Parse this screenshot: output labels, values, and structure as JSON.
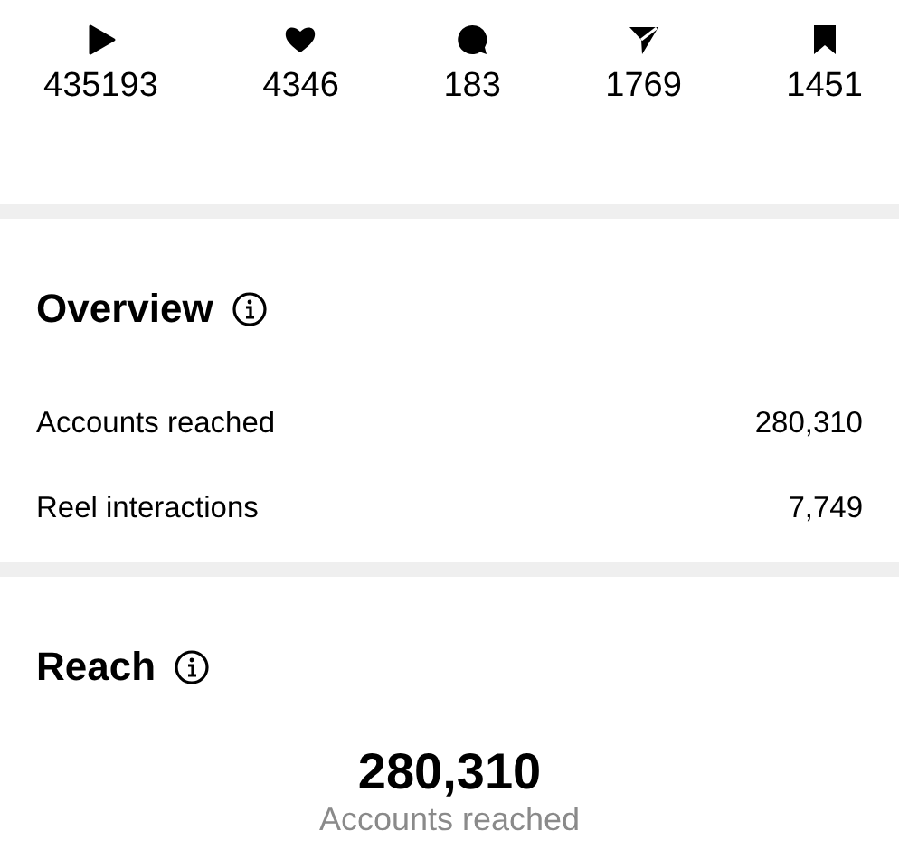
{
  "stats": [
    {
      "kind": "plays",
      "value": "435193"
    },
    {
      "kind": "likes",
      "value": "4346"
    },
    {
      "kind": "comments",
      "value": "183"
    },
    {
      "kind": "shares",
      "value": "1769"
    },
    {
      "kind": "saves",
      "value": "1451"
    }
  ],
  "overview": {
    "title": "Overview",
    "rows": [
      {
        "label": "Accounts reached",
        "value": "280,310"
      },
      {
        "label": "Reel interactions",
        "value": "7,749"
      }
    ]
  },
  "reach": {
    "title": "Reach",
    "value": "280,310",
    "caption": "Accounts reached"
  }
}
